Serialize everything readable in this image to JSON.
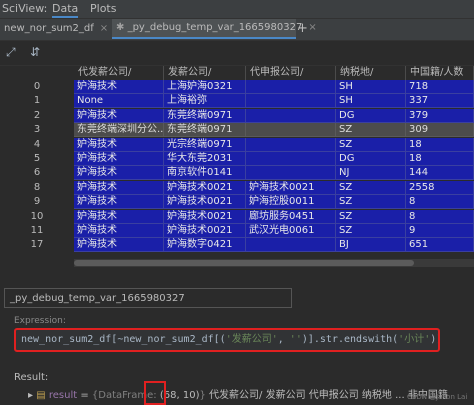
{
  "menubar": {
    "title": "SciView:",
    "tabs": [
      "Data",
      "Plots"
    ],
    "active_tab": "Data"
  },
  "tabs": [
    {
      "label": "new_nor_sum2_df",
      "close": "×"
    },
    {
      "label": "_py_debug_temp_var_1665980327",
      "close": "×"
    }
  ],
  "add_tab": "+",
  "toolbar": {
    "open_icon": "⤢",
    "dropdown_icon": "⇵"
  },
  "grid": {
    "columns": [
      "代发薪公司/",
      "发薪公司/",
      "代申报公司/",
      "纳税地/",
      "中国籍/人数"
    ],
    "rows": [
      {
        "index": "0",
        "cells": [
          "妒海技术",
          "上海妒海0321",
          "",
          "SH",
          "718"
        ]
      },
      {
        "index": "1",
        "cells": [
          "None",
          "上海裕弥",
          "",
          "SH",
          "337"
        ]
      },
      {
        "index": "2",
        "cells": [
          "妒海技术",
          "东莞终端0971",
          "",
          "DG",
          "379"
        ]
      },
      {
        "index": "3",
        "cells": [
          "东莞终端深圳分公...",
          "东莞终端0971",
          "",
          "SZ",
          "309"
        ]
      },
      {
        "index": "4",
        "cells": [
          "妒海技术",
          "光宗终端0971",
          "",
          "SZ",
          "18"
        ]
      },
      {
        "index": "5",
        "cells": [
          "妒海技术",
          "华大东莞2031",
          "",
          "DG",
          "18"
        ]
      },
      {
        "index": "6",
        "cells": [
          "妒海技术",
          "南京软件0141",
          "",
          "NJ",
          "144"
        ]
      },
      {
        "index": "8",
        "cells": [
          "妒海技术",
          "妒海技术0021",
          "妒海技术0021",
          "SZ",
          "2558"
        ]
      },
      {
        "index": "9",
        "cells": [
          "妒海技术",
          "妒海技术0021",
          "妒海控股0011",
          "SZ",
          "8"
        ]
      },
      {
        "index": "10",
        "cells": [
          "妒海技术",
          "妒海技术0021",
          "廊坊服务0451",
          "SZ",
          "8"
        ]
      },
      {
        "index": "11",
        "cells": [
          "妒海技术",
          "妒海技术0021",
          "武汉光电0061",
          "SZ",
          "9"
        ]
      },
      {
        "index": "17",
        "cells": [
          "妒海技术",
          "妒海数字0421",
          "",
          "BJ",
          "651"
        ]
      }
    ]
  },
  "var_name": "_py_debug_temp_var_1665980327",
  "expression": {
    "label": "Expression:",
    "prefix": "new_nor_sum2_df[~new_nor_sum2_df[(",
    "str1": "'发薪公司'",
    "sep": ", ",
    "str2": "''",
    "suffix": ")].str.endswith(",
    "str3": "'小计'",
    "end": ")]"
  },
  "result": {
    "label": "Result:",
    "expand_icon": "▸",
    "name": "result",
    "eq": " = ",
    "type_open": "{DataFrame: ",
    "shape": "(68, 10)",
    "type_close": "}",
    "columns_preview": " 代发薪公司/    发薪公司 代申报公司    纳税地 ... 非中国籍"
  },
  "watermark": "CSDN @Jason Lai"
}
